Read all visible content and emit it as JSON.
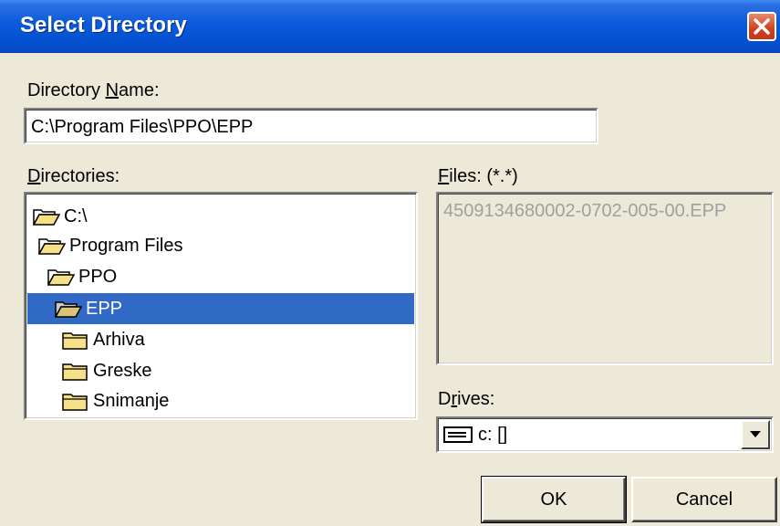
{
  "window": {
    "title": "Select Directory"
  },
  "directory_name": {
    "label_prefix": "Directory ",
    "label_accel": "N",
    "label_suffix": "ame:",
    "value": "C:\\Program Files\\PPO\\EPP"
  },
  "directories": {
    "label_accel": "D",
    "label_suffix": "irectories:",
    "items": [
      {
        "name": "C:\\",
        "icon": "open-folder-icon",
        "selected": false
      },
      {
        "name": "Program Files",
        "icon": "open-folder-icon",
        "selected": false
      },
      {
        "name": "PPO",
        "icon": "open-folder-icon",
        "selected": false
      },
      {
        "name": "EPP",
        "icon": "open-folder-icon",
        "selected": true
      },
      {
        "name": "Arhiva",
        "icon": "closed-folder-icon",
        "selected": false
      },
      {
        "name": "Greske",
        "icon": "closed-folder-icon",
        "selected": false
      },
      {
        "name": "Snimanje",
        "icon": "closed-folder-icon",
        "selected": false
      }
    ]
  },
  "files": {
    "label_accel": "F",
    "label_suffix": "iles: (*.*)",
    "items": [
      "4509134680002-0702-005-00.EPP"
    ]
  },
  "drives": {
    "label_prefix": "D",
    "label_accel": "r",
    "label_suffix": "ives:",
    "selected": "c: []",
    "icon": "hard-drive-icon"
  },
  "buttons": {
    "ok": "OK",
    "cancel": "Cancel"
  },
  "colors": {
    "title_bar": "#0a5bdc",
    "selection": "#316ac5",
    "close": "#d2401c"
  }
}
